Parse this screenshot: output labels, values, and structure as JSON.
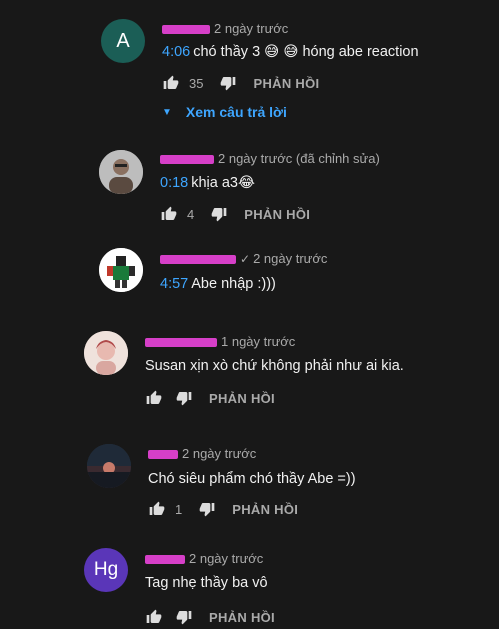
{
  "colors": {
    "background": "#181818",
    "link": "#3ea6ff",
    "author_mask": "#d63fc8",
    "secondary": "#aaaaaa"
  },
  "reply_label": "PHẢN HỒI",
  "view_replies_label": "Xem câu trả lời",
  "comments": [
    {
      "avatar_letter": "A",
      "avatar_color": "#1b5e56",
      "time": "2 ngày trước",
      "timestamp": "4:06",
      "text": "chó thầy 3 😅 😅 hóng abe reaction",
      "likes": "35"
    },
    {
      "avatar_letter": "",
      "avatar_color": "#c9c9c9",
      "time": "2 ngày trước (đã chỉnh sửa)",
      "timestamp": "0:18",
      "text": "khịa a3😂",
      "likes": "4"
    },
    {
      "avatar_letter": "",
      "avatar_color": "#ffffff",
      "time": "2 ngày trước",
      "timestamp": "4:57",
      "text": "Abe nhập :)))",
      "likes": ""
    },
    {
      "avatar_letter": "",
      "avatar_color": "#e8d8d2",
      "time": "1 ngày trước",
      "timestamp": "",
      "text": "Susan xịn xò chứ không phải như ai kia.",
      "likes": ""
    },
    {
      "avatar_letter": "",
      "avatar_color": "#2c3a4a",
      "time": "2 ngày trước",
      "timestamp": "",
      "text": "Chó siêu phẩm chó thầy Abe =))",
      "likes": "1"
    },
    {
      "avatar_letter": "Hg",
      "avatar_color": "#5a36b8",
      "time": "2 ngày trước",
      "timestamp": "",
      "text": "Tag nhẹ thầy ba vô",
      "likes": ""
    }
  ]
}
